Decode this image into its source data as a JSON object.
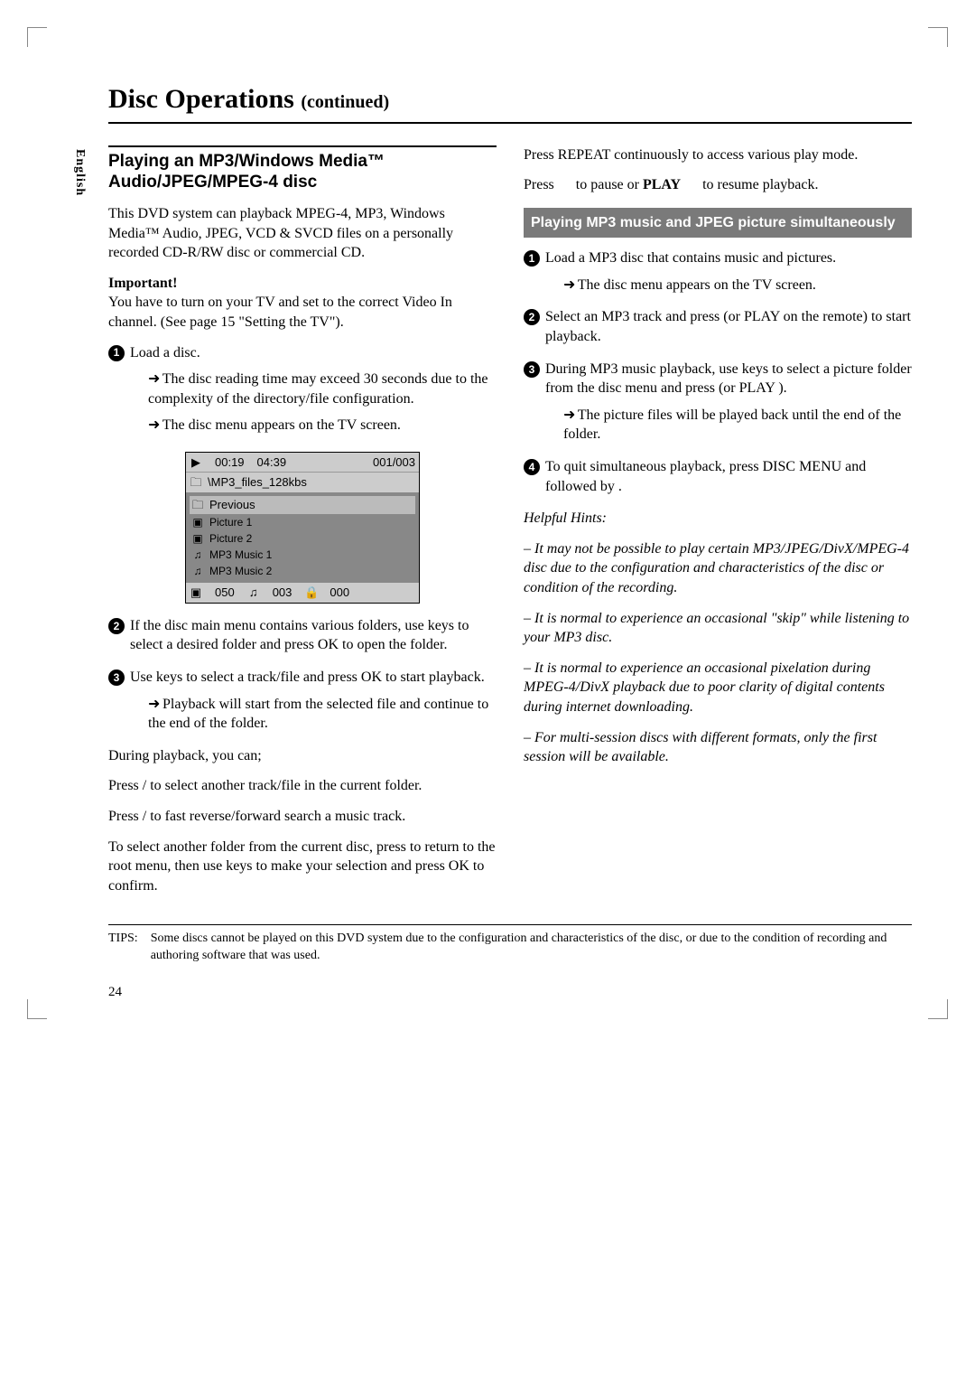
{
  "language_tab": "English",
  "page_title": "Disc Operations",
  "page_title_continued": "(continued)",
  "section_heading": "Playing an MP3/Windows Media™ Audio/JPEG/MPEG-4 disc",
  "intro": "This DVD system can playback MPEG-4, MP3, Windows Media™ Audio, JPEG, VCD & SVCD files on a personally recorded CD-R/RW disc or commercial CD.",
  "important_label": "Important!",
  "important_text": "You have to turn on your TV and set to the correct Video In channel.  (See page 15 \"Setting the TV\").",
  "step1_a": "Load a disc.",
  "step1_b": "The disc reading time may exceed 30 seconds due to the complexity of the directory/file configuration.",
  "step1_c": "The disc menu appears on the TV screen.",
  "disc_menu": {
    "time_elapsed": "00:19",
    "time_total": "04:39",
    "track_count": "001/003",
    "path": "\\MP3_files_128kbs",
    "previous_label": "Previous",
    "items": [
      "Picture 1",
      "Picture 2",
      "MP3 Music 1",
      "MP3 Music 2"
    ],
    "footer_a": "050",
    "footer_b": "003",
    "footer_c": "000"
  },
  "step2": "If the disc main menu contains various folders, use         keys to select a desired folder and press OK to open the folder.",
  "step3_a": "Use         keys to select a track/file and press OK to start playback.",
  "step3_b": "Playback will start from the selected file and continue to the end of the folder.",
  "during_intro": "During playback, you can;",
  "during_1": "Press          /         to select another track/file in the current folder.",
  "during_2": "Press     /     to fast reverse/forward search a music track.",
  "during_3": "To select another folder from the current disc, press       to return to the root menu, then use         keys to make your selection and press OK to confirm.",
  "col2_1": "Press REPEAT continuously to access various play mode.",
  "col2_2_a": "Press",
  "col2_2_b": "to pause or",
  "col2_2_c": "PLAY",
  "col2_2_d": "to resume playback.",
  "sub_heading": "Playing MP3 music and JPEG picture simultaneously",
  "r_step1_a": "Load a MP3 disc that contains music and pictures.",
  "r_step1_b": "The disc menu appears on the TV screen.",
  "r_step2": "Select an MP3 track and press       (or PLAY       on the remote) to start playback.",
  "r_step3_a": "During MP3 music playback, use keys to select a picture folder from the disc menu and press        (or PLAY       ).",
  "r_step3_b": "The picture files will be played back until the end of the folder.",
  "r_step4": "To quit simultaneous playback, press DISC MENU and followed by      .",
  "hints_label": "Helpful Hints:",
  "hint1": "– It may not be possible to play certain MP3/JPEG/DivX/MPEG-4 disc due to the configuration and characteristics of the disc or condition of the recording.",
  "hint2": "– It is normal to experience an occasional \"skip\" while listening to your MP3 disc.",
  "hint3": "– It is normal to experience an occasional pixelation during MPEG-4/DivX playback due to poor clarity of digital contents during internet downloading.",
  "hint4": "– For multi-session discs with different formats, only the first session will be available.",
  "tips_label": "TIPS:",
  "tips_text": "Some discs cannot be played on this DVD system due to the configuration and characteristics of the disc, or due to the condition of recording and authoring software that was used.",
  "page_number": "24"
}
